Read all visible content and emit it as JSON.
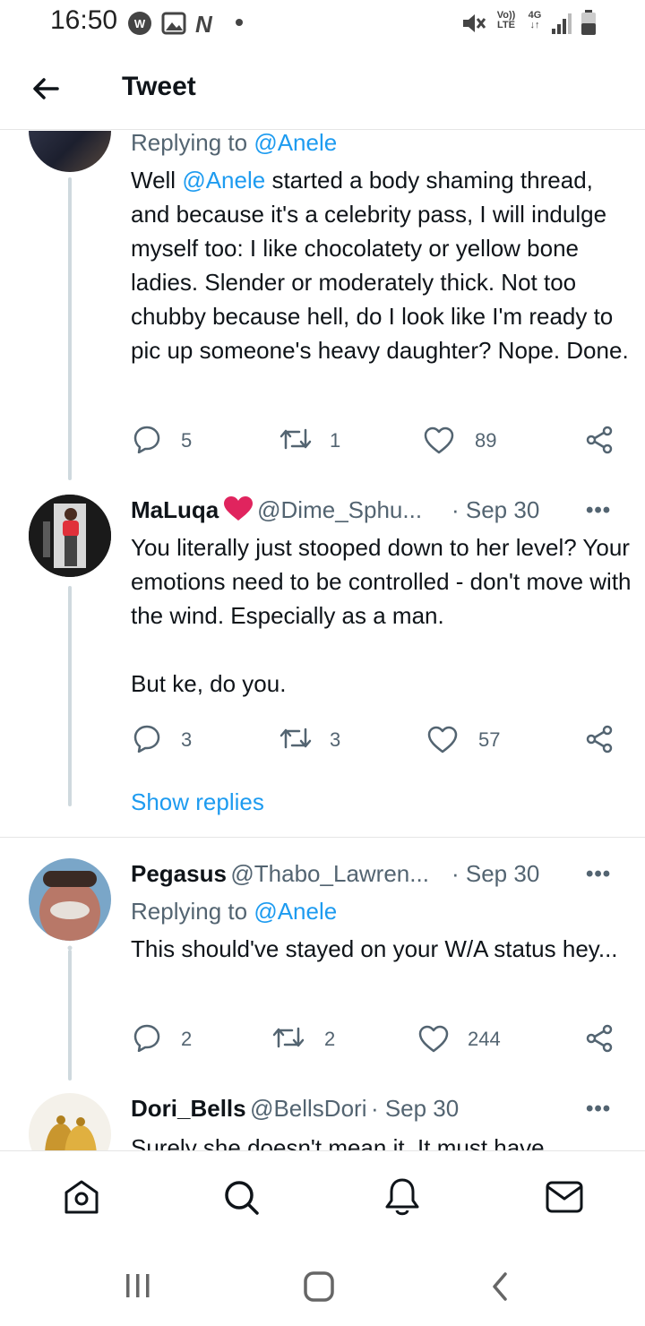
{
  "status_bar": {
    "time": "16:50",
    "volte": "Vo))",
    "lte": "LTE",
    "network": "4G",
    "arrows": "↓↑"
  },
  "header": {
    "title": "Tweet"
  },
  "tweet1": {
    "replying_prefix": "Replying to ",
    "replying_handle": "@Anele",
    "text_1": "Well ",
    "text_mention": "@Anele",
    "text_2": " started a body shaming thread, and because it's a celebrity pass, I will indulge myself too: I like chocolatety or yellow bone ladies. Slender or moderately thick. Not too chubby because hell, do I look like I'm ready to pic up someone's heavy daughter? Nope. Done.",
    "replies": "5",
    "retweets": "1",
    "likes": "89"
  },
  "tweet2": {
    "name": "MaLuqa",
    "handle": "@Dime_Sphu...",
    "date": "· Sep 30",
    "text": "You literally just stooped down to her level? Your emotions need to be controlled - don't move with the wind. Especially as a man.\n\nBut ke, do you.",
    "replies": "3",
    "retweets": "3",
    "likes": "57",
    "show_replies": "Show replies"
  },
  "tweet3": {
    "name": "Pegasus",
    "handle": "@Thabo_Lawren...",
    "date": "· Sep 30",
    "replying_prefix": "Replying to ",
    "replying_handle": "@Anele",
    "text": "This should've stayed on your W/A status hey...",
    "replies": "2",
    "retweets": "2",
    "likes": "244"
  },
  "tweet4": {
    "name": "Dori_Bells",
    "handle": "@BellsDori",
    "date": "· Sep 30",
    "text": "Surely she doesn't mean it. It must have"
  },
  "more_label": "•••",
  "colors": {
    "accent": "#1d9bf0",
    "heart": "#e0245e",
    "secondary": "#536471"
  },
  "icons": [
    "back-arrow-icon",
    "reply-icon",
    "retweet-icon",
    "like-icon",
    "share-icon",
    "home-icon",
    "search-icon",
    "notifications-icon",
    "messages-icon"
  ]
}
